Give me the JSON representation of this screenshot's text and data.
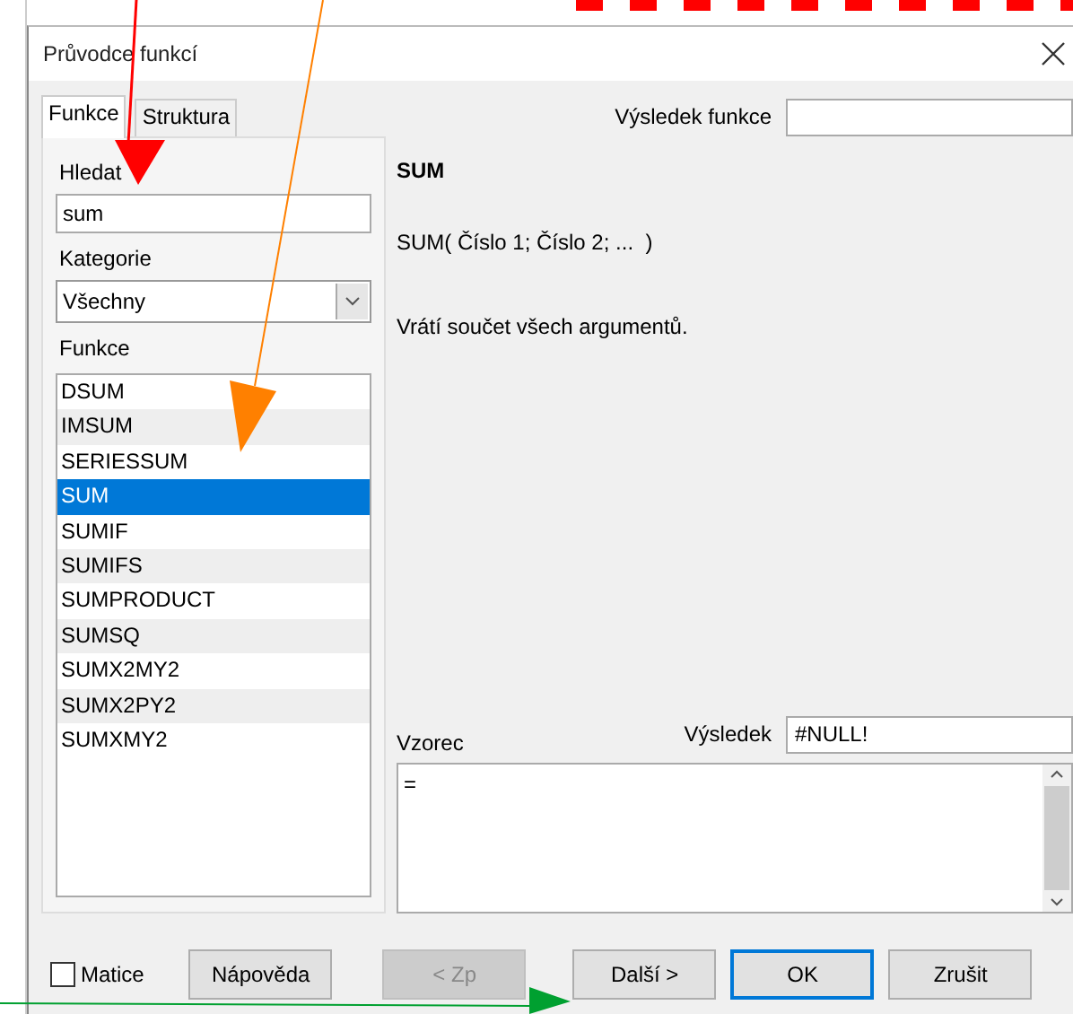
{
  "window": {
    "title": "Průvodce funkcí"
  },
  "tabs": [
    {
      "label": "Funkce",
      "selected": true
    },
    {
      "label": "Struktura",
      "selected": false
    }
  ],
  "search": {
    "label": "Hledat",
    "value": "sum"
  },
  "category": {
    "label": "Kategorie",
    "value": "Všechny"
  },
  "functions": {
    "label": "Funkce",
    "items": [
      {
        "name": "DSUM",
        "selected": false
      },
      {
        "name": "IMSUM",
        "selected": false
      },
      {
        "name": "SERIESSUM",
        "selected": false
      },
      {
        "name": "SUM",
        "selected": true
      },
      {
        "name": "SUMIF",
        "selected": false
      },
      {
        "name": "SUMIFS",
        "selected": false
      },
      {
        "name": "SUMPRODUCT",
        "selected": false
      },
      {
        "name": "SUMSQ",
        "selected": false
      },
      {
        "name": "SUMX2MY2",
        "selected": false
      },
      {
        "name": "SUMX2PY2",
        "selected": false
      },
      {
        "name": "SUMXMY2",
        "selected": false
      }
    ]
  },
  "function_result": {
    "label": "Výsledek funkce"
  },
  "selected_function": {
    "name": "SUM",
    "syntax": "SUM( Číslo 1; Číslo 2; ...  )",
    "description": "Vrátí součet všech argumentů."
  },
  "formula": {
    "label": "Vzorec",
    "value": "="
  },
  "result": {
    "label": "Výsledek",
    "value": "#NULL!"
  },
  "array": {
    "label": "Matice",
    "checked": false
  },
  "buttons": [
    {
      "label": "Nápověda",
      "disabled": false,
      "default": false
    },
    {
      "label": "< Zp",
      "disabled": true,
      "default": false
    },
    {
      "label": "Další >",
      "disabled": false,
      "default": false
    },
    {
      "label": "OK",
      "disabled": false,
      "default": true
    },
    {
      "label": "Zrušit",
      "disabled": false,
      "default": false
    }
  ]
}
